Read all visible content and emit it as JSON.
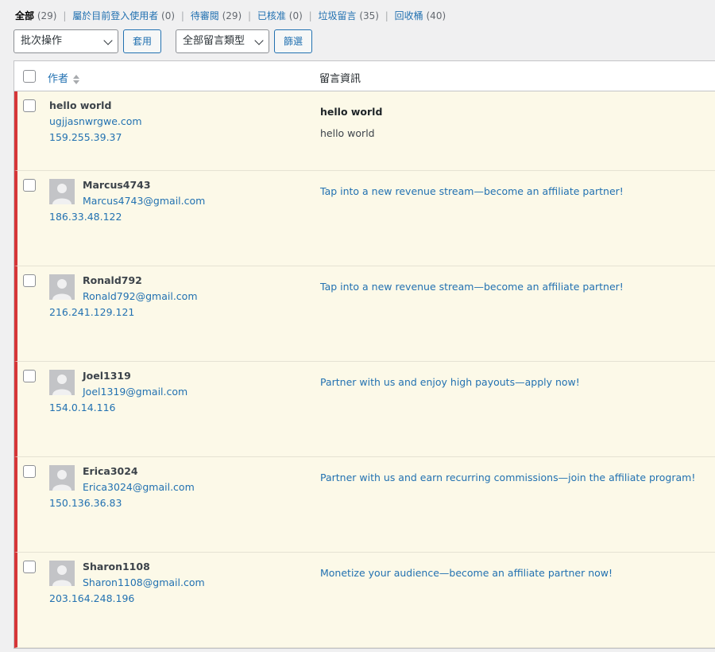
{
  "filters": [
    {
      "label": "全部",
      "count": "(29)",
      "current": true
    },
    {
      "label": "屬於目前登入使用者",
      "count": "(0)"
    },
    {
      "label": "待審閱",
      "count": "(29)"
    },
    {
      "label": "已核准",
      "count": "(0)"
    },
    {
      "label": "垃圾留言",
      "count": "(35)"
    },
    {
      "label": "回收桶",
      "count": "(40)"
    }
  ],
  "separator": "|",
  "toolbar": {
    "bulk_select": "批次操作",
    "apply_label": "套用",
    "type_select": "全部留言類型",
    "filter_label": "篩選"
  },
  "table": {
    "col_author": "作者",
    "col_comment": "留言資訊"
  },
  "rows": [
    {
      "name": "hello world",
      "email": "ugjjasnwrgwe.com",
      "ip": "159.255.39.37",
      "title": "hello world",
      "text": "hello world"
    },
    {
      "name": "Marcus4743",
      "email": "Marcus4743@gmail.com",
      "ip": "186.33.48.122",
      "link": "Tap into a new revenue stream—become an affiliate partner!"
    },
    {
      "name": "Ronald792",
      "email": "Ronald792@gmail.com",
      "ip": "216.241.129.121",
      "link": "Tap into a new revenue stream—become an affiliate partner!"
    },
    {
      "name": "Joel1319",
      "email": "Joel1319@gmail.com",
      "ip": "154.0.14.116",
      "link": "Partner with us and enjoy high payouts—apply now!"
    },
    {
      "name": "Erica3024",
      "email": "Erica3024@gmail.com",
      "ip": "150.136.36.83",
      "link": "Partner with us and earn recurring commissions—join the affiliate program!"
    },
    {
      "name": "Sharon1108",
      "email": "Sharon1108@gmail.com",
      "ip": "203.164.248.196",
      "link": "Monetize your audience—become an affiliate partner now!"
    }
  ],
  "colors": {
    "accent": "#2271b1",
    "pending_border": "#d63638",
    "pending_bg": "#fcf9e8"
  },
  "icons": [
    "sort-icon",
    "chevron-down-icon",
    "avatar-placeholder-icon",
    "checkbox"
  ]
}
